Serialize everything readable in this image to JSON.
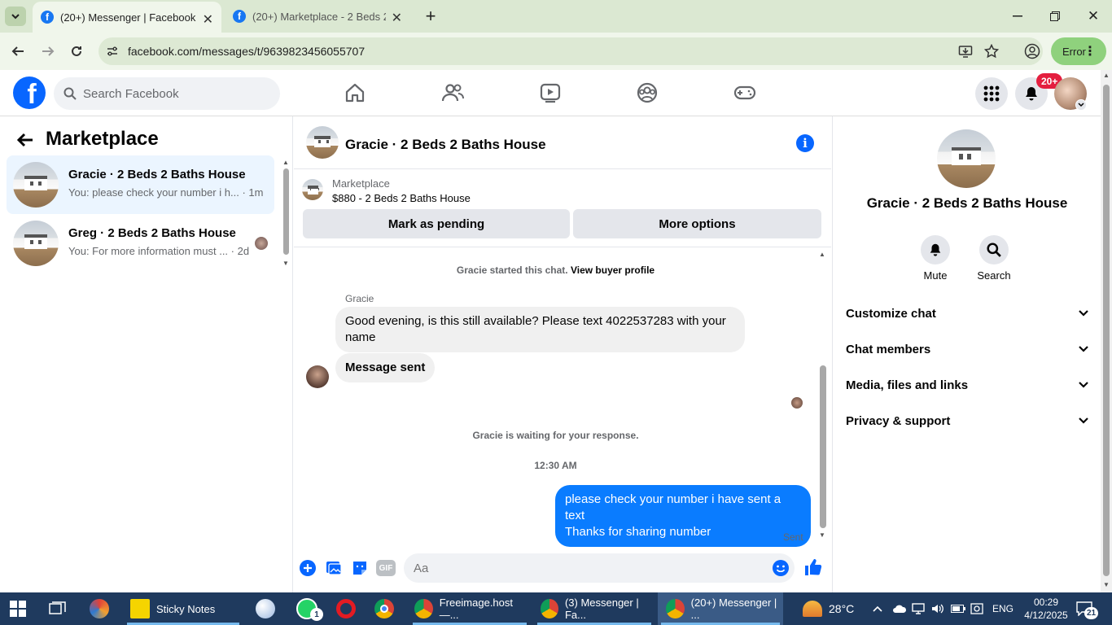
{
  "browser": {
    "tabs": [
      {
        "title": "(20+) Messenger | Facebook",
        "active": true
      },
      {
        "title": "(20+) Marketplace - 2 Beds 2 Ba",
        "active": false
      }
    ],
    "url": "facebook.com/messages/t/9639823456055707",
    "profile_status": "Error"
  },
  "fb_header": {
    "search_placeholder": "Search Facebook",
    "notification_badge": "20+"
  },
  "left_panel": {
    "title": "Marketplace",
    "conversations": [
      {
        "name": "Gracie · 2 Beds 2 Baths House",
        "preview": "You: please check your number i h...",
        "time": "· 1m",
        "selected": true
      },
      {
        "name": "Greg · 2 Beds 2 Baths House",
        "preview": "You: For more information must ...",
        "time": "· 2d",
        "selected": false
      }
    ]
  },
  "chat": {
    "header_name": "Gracie · 2 Beds 2 Baths House",
    "listing_label": "Marketplace",
    "listing_title": "$880 - 2 Beds 2 Baths House",
    "mark_pending": "Mark as pending",
    "more_options": "More options",
    "started_text": "Gracie started this chat.",
    "view_profile": "View buyer profile",
    "sender_label": "Gracie",
    "msg1": "Good evening, is this still available? Please text 4022537283 with your name",
    "msg2": "Message sent",
    "waiting_text": "Gracie is waiting for your response.",
    "timestamp": "12:30 AM",
    "my_msg_line1": "please check your number i have sent a text",
    "my_msg_line2": "Thanks for sharing number",
    "sent_status": "Sent",
    "composer_placeholder": "Aa",
    "gif_label": "GIF"
  },
  "right_panel": {
    "name": "Gracie · 2 Beds 2 Baths House",
    "actions": [
      {
        "label": "Mute",
        "icon": "bell-icon"
      },
      {
        "label": "Search",
        "icon": "search-icon"
      }
    ],
    "sections": [
      "Customize chat",
      "Chat members",
      "Media, files and links",
      "Privacy & support"
    ]
  },
  "taskbar": {
    "apps": [
      {
        "label": "Sticky Notes"
      },
      {
        "label": "Freeimage.host —..."
      },
      {
        "label": "(3) Messenger | Fa..."
      },
      {
        "label": "(20+) Messenger | ..."
      }
    ],
    "whatsapp_badge": "1",
    "temperature": "28°C",
    "language": "ENG",
    "time": "00:29",
    "date": "4/12/2025",
    "notifications": "21"
  },
  "colors": {
    "fb_blue": "#0866ff",
    "bubble_blue": "#0a7cff",
    "badge_red": "#e41e3f"
  }
}
